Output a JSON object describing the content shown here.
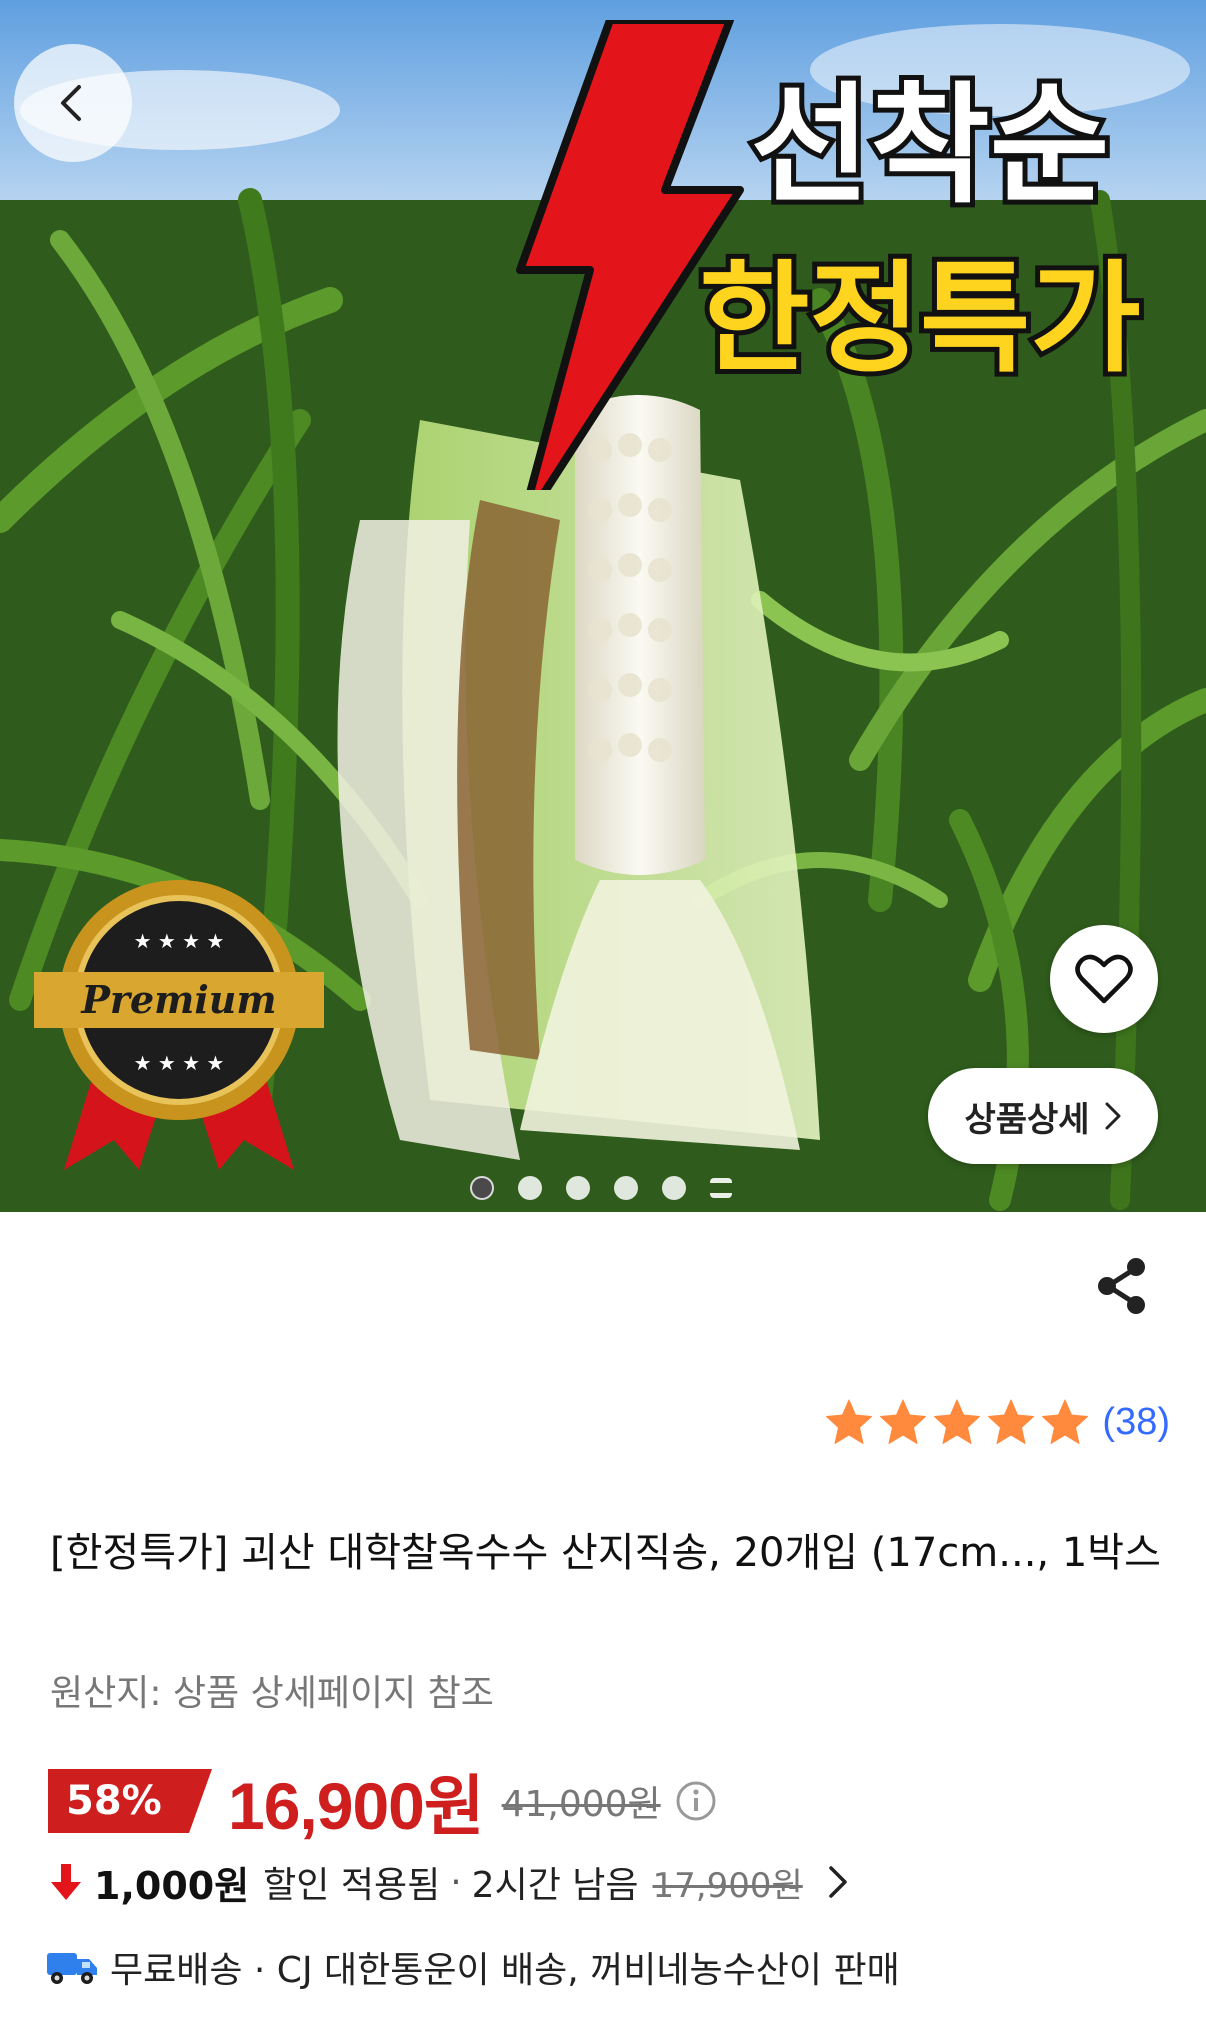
{
  "hero": {
    "promo_line1": "선착순",
    "promo_line2": "한정특가",
    "badge_text": "Premium",
    "badge_stars": "★ ★ ★ ★",
    "detail_button_label": "상품상세",
    "image_count_dots": 5
  },
  "product": {
    "rating_stars": 5,
    "review_count": "(38)",
    "title": "[한정특가] 괴산 대학찰옥수수 산지직송, 20개입 (17cm..., 1박스",
    "origin": "원산지: 상품 상세페이지 참조",
    "discount_rate": "58%",
    "sale_price": "16,900원",
    "original_price": "41,000원",
    "coupon_amount": "1,000원",
    "coupon_text": "할인 적용됨",
    "coupon_separator": "·",
    "coupon_remaining": "2시간 남음",
    "coupon_old_price": "17,900원",
    "delivery_text": "무료배송 · CJ 대한통운이 배송, 꺼비네농수산이 판매"
  },
  "colors": {
    "accent_red": "#ce1e1e",
    "link_blue": "#346aff",
    "star_orange": "#ff8a3d",
    "promo_yellow": "#ffd41f"
  },
  "icons": [
    "back-arrow-icon",
    "heart-icon",
    "chevron-right-icon",
    "share-icon",
    "star-icon",
    "info-icon",
    "down-arrow-icon",
    "truck-icon"
  ]
}
